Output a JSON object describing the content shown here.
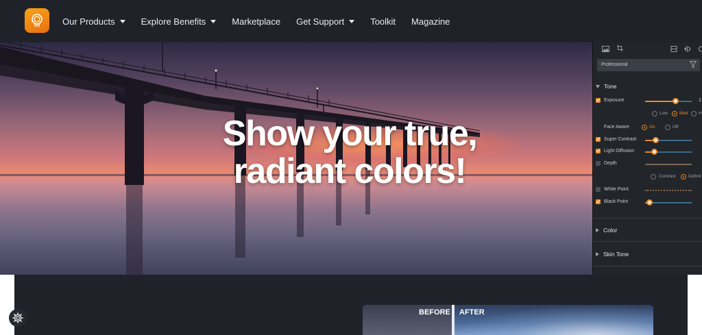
{
  "nav": {
    "logo_icon": "lightbulb-logo-icon",
    "items": [
      {
        "label": "Our Products",
        "has_dropdown": true
      },
      {
        "label": "Explore Benefits",
        "has_dropdown": true
      },
      {
        "label": "Marketplace",
        "has_dropdown": false
      },
      {
        "label": "Get Support",
        "has_dropdown": true
      },
      {
        "label": "Toolkit",
        "has_dropdown": false
      },
      {
        "label": "Magazine",
        "has_dropdown": false
      }
    ]
  },
  "hero": {
    "headline_line1": "Show your true,",
    "headline_line2": "radiant colors!"
  },
  "panel": {
    "preset": "Professional",
    "sections": {
      "tone": "Tone",
      "color": "Color",
      "skin_tone": "Skin Tone"
    },
    "exposure": {
      "label": "Exposure",
      "checked": true,
      "value_text": "1",
      "level": 0.67
    },
    "exposure_modes": {
      "low": "Low",
      "med": "Med",
      "high": "H",
      "selected": "Med"
    },
    "face_aware": {
      "label": "Face Aware",
      "on": "On",
      "off": "Off",
      "selected": "On"
    },
    "super_contrast": {
      "label": "Super Contrast",
      "checked": true,
      "level": 0.23
    },
    "light_diffusion": {
      "label": "Light Diffusion",
      "checked": true,
      "level": 0.19
    },
    "depth": {
      "label": "Depth",
      "checked": false
    },
    "depth_modes": {
      "contrast": "Contrast",
      "definition": "Definit",
      "selected": "Definit"
    },
    "white_point": {
      "label": "White Point",
      "checked": false
    },
    "black_point": {
      "label": "Black Point",
      "checked": true,
      "level": 0.1
    }
  },
  "compare": {
    "before_label": "BEFORE",
    "after_label": "AFTER"
  },
  "colors": {
    "nav_bg": "#1f2329",
    "accent": "#e98a24",
    "panel_bg": "#22252a"
  }
}
